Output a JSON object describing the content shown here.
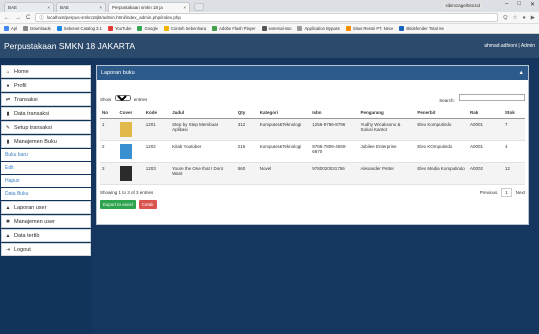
{
  "browser": {
    "tabs": [
      {
        "label": "BAE",
        "close": "×"
      },
      {
        "label": "BAE",
        "close": "×"
      },
      {
        "label": "Perpustakaan smkn 18 ja",
        "close": "×"
      }
    ],
    "profile": "sibimzage/bimzid",
    "controls": {
      "minimize": "–",
      "maximize": "□",
      "close": "✕"
    },
    "nav": {
      "back": "←",
      "forward": "→",
      "reload": "C"
    },
    "url": "localhost/perpus-smkn18jkt/admin.html/index_admin.php/index.php",
    "right_icons": [
      "Q",
      "☆",
      "●",
      "▶"
    ],
    "bookmarks": [
      {
        "label": "Apl",
        "color": "#4285f4"
      },
      {
        "label": "Downloads",
        "color": "#888888"
      },
      {
        "label": "Sebenet Catalog 3.1",
        "color": "#1e88e5"
      },
      {
        "label": "YouTube",
        "color": "#e53935"
      },
      {
        "label": "Google",
        "color": "#34a853"
      },
      {
        "label": "Contoh Sebenhara",
        "color": "#f4b400"
      },
      {
        "label": "Adobe Flash Player",
        "color": "#43a047"
      },
      {
        "label": "external-sso",
        "color": "#555555"
      },
      {
        "label": "Application Bypass",
        "color": "#999999"
      },
      {
        "label": "Situs Resmi PT. Nece",
        "color": "#fb8c00"
      },
      {
        "label": "Bitdefender Total Se",
        "color": "#1565c0"
      }
    ]
  },
  "app": {
    "title": "Perpustakaan SMKN 18 JAKARTA",
    "user": "ahmad.adhioni | Admin"
  },
  "sidebar": {
    "items": [
      {
        "label": "Home",
        "icon": "home-icon",
        "glyph": "⌂"
      },
      {
        "label": "Profil",
        "icon": "user-icon",
        "glyph": "●"
      },
      {
        "label": "Transaksi",
        "icon": "transfer-icon",
        "glyph": "⇄"
      },
      {
        "label": "Data transaksi",
        "icon": "book-icon",
        "glyph": "▮"
      },
      {
        "label": "Setup transaksi",
        "icon": "edit-icon",
        "glyph": "✎"
      },
      {
        "label": "Manajemen Buku",
        "icon": "book-icon",
        "glyph": "▮"
      }
    ],
    "sub_items": [
      "Buku baru",
      "Edit",
      "Hapus",
      "Data Buku"
    ],
    "items2": [
      {
        "label": "Laporan user",
        "icon": "users-icon",
        "glyph": "▲"
      },
      {
        "label": "Manajemen user",
        "icon": "gear-icon",
        "glyph": "✱"
      },
      {
        "label": "Data tertib",
        "icon": "warning-icon",
        "glyph": "▲"
      },
      {
        "label": "Logout",
        "icon": "logout-icon",
        "glyph": "⇥"
      }
    ]
  },
  "panel": {
    "title": "Laporan buku",
    "collapse": "▲",
    "show_label": "Show",
    "show_value": "10",
    "entries_label": "entries",
    "search_label": "Search:",
    "columns": [
      "No",
      "Cover",
      "Kode",
      "Judul",
      "Qty",
      "Kategori",
      "Isbn",
      "Pengarang",
      "Penerbit",
      "Rak",
      "Stok"
    ],
    "rows": [
      {
        "no": "1",
        "kode": "1201",
        "judul": "Step by Step Membuat Aplikasi",
        "qty": "312",
        "kategori": "Komputer&Teknologi",
        "isbn": "1256-8796-8796",
        "pengarang": "Yudhy Wicaksono & Solusi Kantor",
        "penerbit": "Elex Komputindo",
        "rak": "A0001",
        "stok": "7",
        "cover_color": "#e3b84a"
      },
      {
        "no": "2",
        "kode": "1202",
        "judul": "Kitab Youtuber",
        "qty": "216",
        "kategori": "Komputer&Teknologi",
        "isbn": "9786-7809-4590-6870",
        "pengarang": "Jubilee Enterprise",
        "penerbit": "Elex KOmputindo",
        "rak": "A0001",
        "stok": "4",
        "cover_color": "#3a8fd1"
      },
      {
        "no": "3",
        "kode": "1203",
        "judul": "Youre the One that I Dont Want",
        "qty": "560",
        "kategori": "Novel",
        "isbn": "9780020031756",
        "pengarang": "Alexander Petter",
        "penerbit": "Elex Media Komputindo",
        "rak": "A0002",
        "stok": "12",
        "cover_color": "#2b2b2b"
      }
    ],
    "showing": "Showing 1 to 3 of 3 entries",
    "previous": "Previous",
    "page": "1",
    "next": "Next",
    "export_label": "Export to excel",
    "print_label": "Cetak"
  },
  "colors": {
    "header": "#2c4a6b",
    "panel_head": "#2c5b8b",
    "sidebar_bg": "#12335a",
    "green": "#2ea44f",
    "red": "#d9534f"
  }
}
